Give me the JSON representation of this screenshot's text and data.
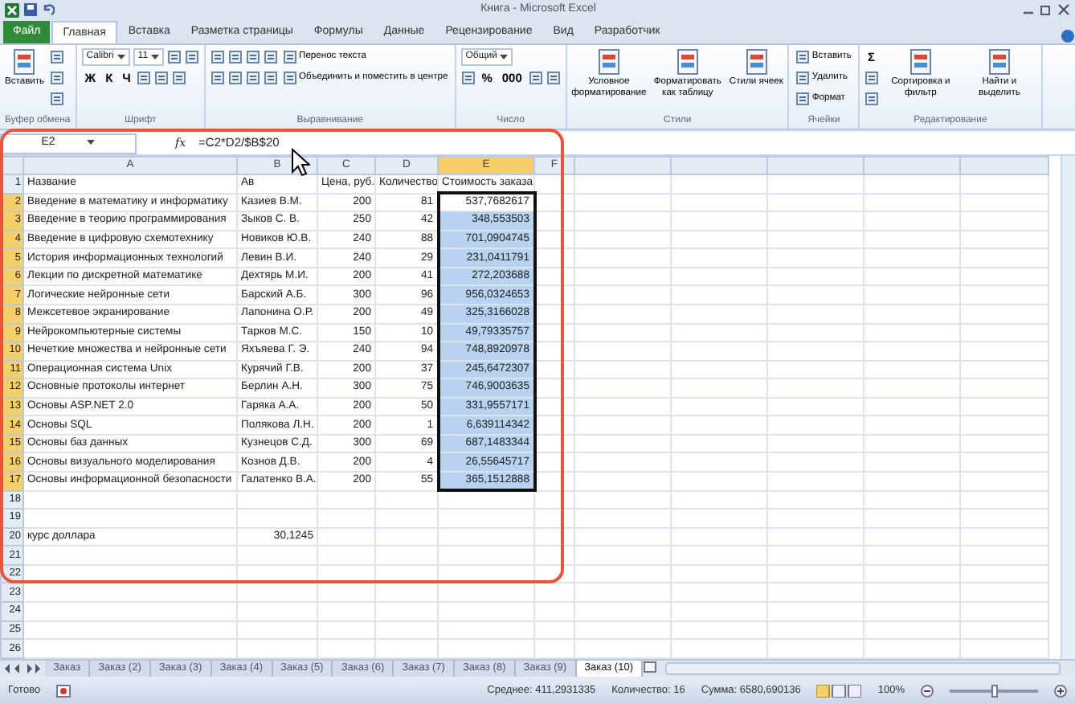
{
  "window": {
    "title": "Книга - Microsoft Excel"
  },
  "ribbon": {
    "tabs": [
      {
        "label": "Файл",
        "kind": "file",
        "selected": false
      },
      {
        "label": "Главная",
        "kind": "tab",
        "selected": true
      },
      {
        "label": "Вставка",
        "kind": "tab",
        "selected": false
      },
      {
        "label": "Разметка страницы",
        "kind": "tab",
        "selected": false
      },
      {
        "label": "Формулы",
        "kind": "tab",
        "selected": false
      },
      {
        "label": "Данные",
        "kind": "tab",
        "selected": false
      },
      {
        "label": "Рецензирование",
        "kind": "tab",
        "selected": false
      },
      {
        "label": "Вид",
        "kind": "tab",
        "selected": false
      },
      {
        "label": "Разработчик",
        "kind": "tab",
        "selected": false
      }
    ],
    "groups": [
      {
        "label": "Буфер обмена",
        "big": [
          "Вставить"
        ],
        "lines": [
          [
            {
              "kind": "tool"
            }
          ],
          [
            {
              "kind": "tool"
            }
          ],
          [
            {
              "kind": "tool"
            }
          ]
        ]
      },
      {
        "label": "Шрифт",
        "lines": [
          [
            {
              "kind": "field",
              "value": "Calibri"
            },
            {
              "kind": "field",
              "value": "11"
            },
            {
              "kind": "tool"
            },
            {
              "kind": "tool"
            }
          ],
          [
            {
              "kind": "glyph",
              "label": "Ж"
            },
            {
              "kind": "glyph",
              "label": "К"
            },
            {
              "kind": "glyph",
              "label": "Ч"
            },
            {
              "kind": "tool"
            },
            {
              "kind": "tool"
            },
            {
              "kind": "tool"
            }
          ]
        ]
      },
      {
        "label": "Выравнивание",
        "lines": [
          [
            {
              "kind": "tool"
            },
            {
              "kind": "tool"
            },
            {
              "kind": "tool"
            },
            {
              "kind": "tool"
            },
            {
              "kind": "text",
              "label": "Перенос текста"
            }
          ],
          [
            {
              "kind": "tool"
            },
            {
              "kind": "tool"
            },
            {
              "kind": "tool"
            },
            {
              "kind": "tool"
            },
            {
              "kind": "text",
              "label": "Объединить и поместить в центре"
            }
          ]
        ]
      },
      {
        "label": "Число",
        "lines": [
          [
            {
              "kind": "field",
              "value": "Общий"
            }
          ],
          [
            {
              "kind": "tool"
            },
            {
              "kind": "glyph",
              "label": "%"
            },
            {
              "kind": "glyph",
              "label": "000"
            },
            {
              "kind": "tool"
            },
            {
              "kind": "tool"
            }
          ]
        ]
      },
      {
        "label": "Стили",
        "big": [
          "Условное форматирование",
          "Форматировать как таблицу",
          "Стили ячеек"
        ]
      },
      {
        "label": "Ячейки",
        "lines": [
          [
            {
              "kind": "text",
              "label": "Вставить"
            }
          ],
          [
            {
              "kind": "text",
              "label": "Удалить"
            }
          ],
          [
            {
              "kind": "text",
              "label": "Формат"
            }
          ]
        ]
      },
      {
        "label": "Редактирование",
        "lines": [
          [
            {
              "kind": "glyph",
              "label": "Σ"
            }
          ],
          [
            {
              "kind": "tool"
            }
          ],
          [
            {
              "kind": "tool"
            }
          ]
        ],
        "big": [
          "Сортировка и фильтр",
          "Найти и выделить"
        ]
      }
    ]
  },
  "formula_bar": {
    "name_box": "E2",
    "fx": "fx",
    "formula": "=C2*D2/$B$20"
  },
  "sheet": {
    "columns": [
      {
        "label": "A",
        "selected": false
      },
      {
        "label": "B",
        "selected": false
      },
      {
        "label": "C",
        "selected": false
      },
      {
        "label": "D",
        "selected": false
      },
      {
        "label": "E",
        "selected": true
      },
      {
        "label": "F",
        "selected": false
      }
    ],
    "rows": [
      {
        "number": "1",
        "selected": false,
        "cells": [
          "Название",
          "Ав",
          "Цена, руб.",
          "Количество",
          "Стоимость заказа",
          null
        ]
      },
      {
        "number": "2",
        "selected": true,
        "cells": [
          "Введение в математику и информатику",
          "Казиев В.М.",
          "200",
          "81",
          "537,7682617",
          null
        ]
      },
      {
        "number": "3",
        "selected": true,
        "cells": [
          "Введение в теорию программирования",
          "Зыков С. В.",
          "250",
          "42",
          "348,553503",
          null
        ]
      },
      {
        "number": "4",
        "selected": true,
        "cells": [
          "Введение в цифровую схемотехнику",
          "Новиков Ю.В.",
          "240",
          "88",
          "701,0904745",
          null
        ]
      },
      {
        "number": "5",
        "selected": true,
        "cells": [
          "История информационных технологий",
          "Левин В.И.",
          "240",
          "29",
          "231,0411791",
          null
        ]
      },
      {
        "number": "6",
        "selected": true,
        "cells": [
          "Лекции по дискретной математике",
          "Дехтярь М.И.",
          "200",
          "41",
          "272,203688",
          null
        ]
      },
      {
        "number": "7",
        "selected": true,
        "cells": [
          "Логические нейронные сети",
          "Барский А.Б.",
          "300",
          "96",
          "956,0324653",
          null
        ]
      },
      {
        "number": "8",
        "selected": true,
        "cells": [
          "Межсетевое экранирование",
          "Лапонина О.Р.",
          "200",
          "49",
          "325,3166028",
          null
        ]
      },
      {
        "number": "9",
        "selected": true,
        "cells": [
          "Нейрокомпьютерные системы",
          "Тарков М.С.",
          "150",
          "10",
          "49,79335757",
          null
        ]
      },
      {
        "number": "10",
        "selected": true,
        "cells": [
          "Нечеткие множества и нейронные сети",
          "Яхъяева Г. Э.",
          "240",
          "94",
          "748,8920978",
          null
        ]
      },
      {
        "number": "11",
        "selected": true,
        "cells": [
          "Операционная система Unix",
          "Курячий Г.В.",
          "200",
          "37",
          "245,6472307",
          null
        ]
      },
      {
        "number": "12",
        "selected": true,
        "cells": [
          "Основные протоколы интернет",
          "Берлин А.Н.",
          "300",
          "75",
          "746,9003635",
          null
        ]
      },
      {
        "number": "13",
        "selected": true,
        "cells": [
          "Основы ASP.NET 2.0",
          "Гаряка А.А.",
          "200",
          "50",
          "331,9557171",
          null
        ]
      },
      {
        "number": "14",
        "selected": true,
        "cells": [
          "Основы SQL",
          "Полякова Л.Н.",
          "200",
          "1",
          "6,639114342",
          null
        ]
      },
      {
        "number": "15",
        "selected": true,
        "cells": [
          "Основы баз данных",
          "Кузнецов С.Д.",
          "300",
          "69",
          "687,1483344",
          null
        ]
      },
      {
        "number": "16",
        "selected": true,
        "cells": [
          "Основы визуального моделирования",
          "Кознов Д.В.",
          "200",
          "4",
          "26,55645717",
          null
        ]
      },
      {
        "number": "17",
        "selected": true,
        "cells": [
          "Основы информационной безопасности",
          "Галатенко В.А.",
          "200",
          "55",
          "365,1512888",
          null
        ]
      },
      {
        "number": "18",
        "selected": false,
        "cells": [
          null,
          null,
          null,
          null,
          null,
          null
        ]
      },
      {
        "number": "19",
        "selected": false,
        "cells": [
          null,
          null,
          null,
          null,
          null,
          null
        ]
      },
      {
        "number": "20",
        "selected": false,
        "cells": [
          "курс доллара",
          "30,1245",
          null,
          null,
          null,
          null
        ]
      },
      {
        "number": "21",
        "selected": false,
        "cells": [
          null,
          null,
          null,
          null,
          null,
          null
        ]
      },
      {
        "number": "22",
        "selected": false,
        "cells": [
          null,
          null,
          null,
          null,
          null,
          null
        ]
      },
      {
        "number": "23",
        "selected": false,
        "cells": [
          null,
          null,
          null,
          null,
          null,
          null
        ]
      },
      {
        "number": "24",
        "selected": false,
        "cells": [
          null,
          null,
          null,
          null,
          null,
          null
        ]
      },
      {
        "number": "25",
        "selected": false,
        "cells": [
          null,
          null,
          null,
          null,
          null,
          null
        ]
      },
      {
        "number": "26",
        "selected": false,
        "cells": [
          null,
          null,
          null,
          null,
          null,
          null
        ]
      }
    ]
  },
  "sheet_tabs": [
    {
      "label": "Заказ",
      "selected": false
    },
    {
      "label": "Заказ (2)",
      "selected": false
    },
    {
      "label": "Заказ (3)",
      "selected": false
    },
    {
      "label": "Заказ (4)",
      "selected": false
    },
    {
      "label": "Заказ (5)",
      "selected": false
    },
    {
      "label": "Заказ (6)",
      "selected": false
    },
    {
      "label": "Заказ (7)",
      "selected": false
    },
    {
      "label": "Заказ (8)",
      "selected": false
    },
    {
      "label": "Заказ (9)",
      "selected": false
    },
    {
      "label": "Заказ (10)",
      "selected": true
    }
  ],
  "status_bar": {
    "mode": "Готово",
    "stats": [
      "Среднее: 411,2931335",
      "Количество: 16",
      "Сумма: 6580,690136"
    ],
    "zoom": "100%",
    "zoom_slider": {
      "level": 0.5
    }
  }
}
